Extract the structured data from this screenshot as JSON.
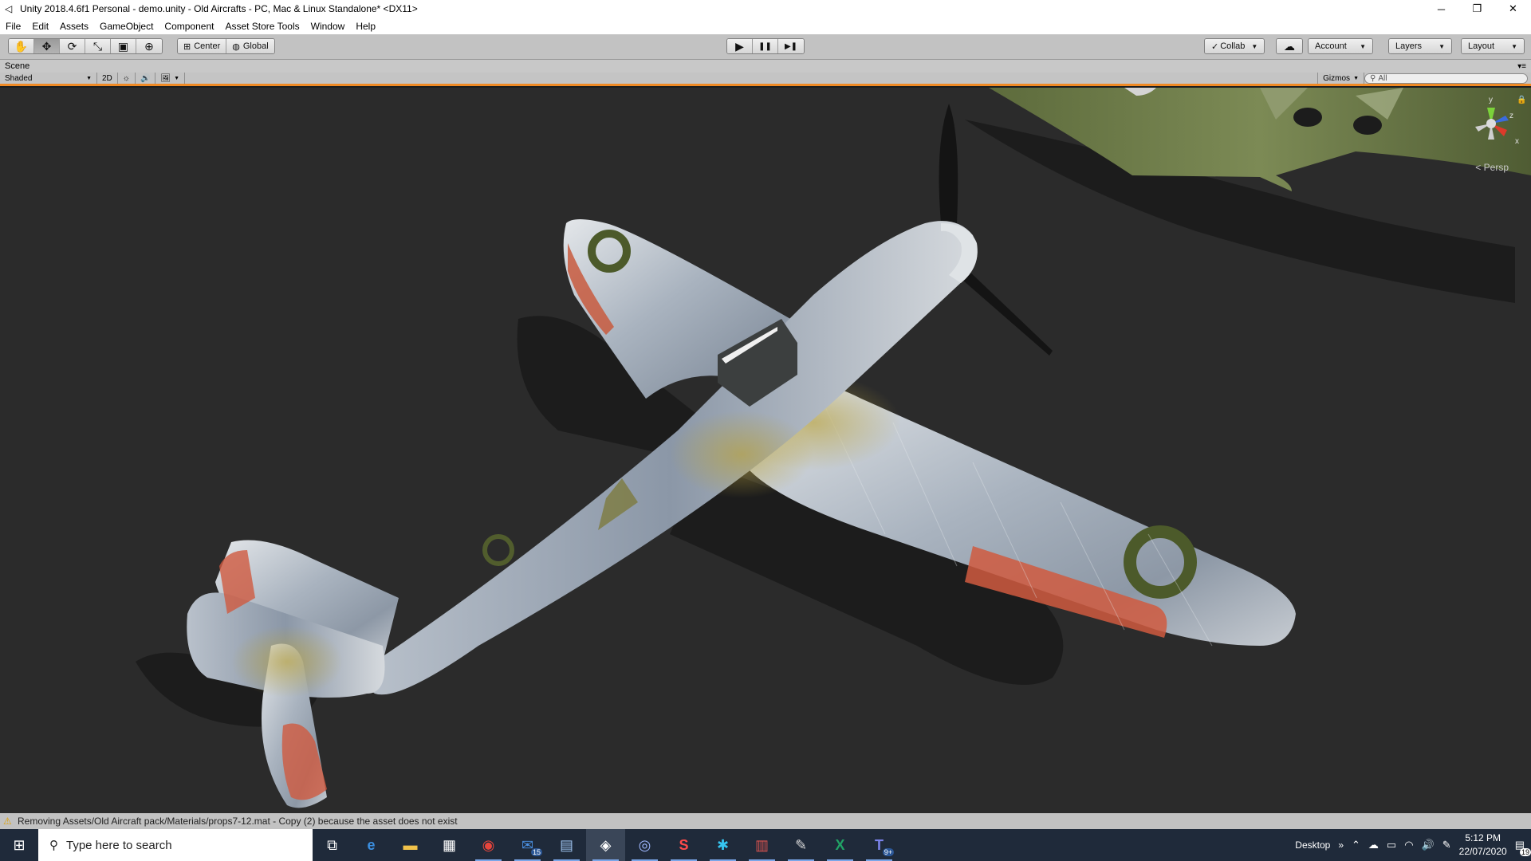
{
  "window": {
    "title": "Unity 2018.4.6f1 Personal - demo.unity - Old Aircrafts - PC, Mac & Linux Standalone* <DX11>",
    "minimize": "─",
    "restore": "❐",
    "close": "✕"
  },
  "menu": [
    "File",
    "Edit",
    "Assets",
    "GameObject",
    "Component",
    "Asset Store Tools",
    "Window",
    "Help"
  ],
  "toolbar": {
    "tools": [
      {
        "name": "hand-tool",
        "glyph": "✋",
        "active": false
      },
      {
        "name": "move-tool",
        "glyph": "✥",
        "active": true
      },
      {
        "name": "rotate-tool",
        "glyph": "⟳",
        "active": false
      },
      {
        "name": "scale-tool",
        "glyph": "⤡",
        "active": false
      },
      {
        "name": "rect-tool",
        "glyph": "▣",
        "active": false
      },
      {
        "name": "transform-tool",
        "glyph": "⊕",
        "active": false
      }
    ],
    "pivot": "Center",
    "space": "Global",
    "play": "▶",
    "pause": "❚❚",
    "step": "▶❚",
    "collab": "Collab",
    "cloud": "☁",
    "account": "Account",
    "layers": "Layers",
    "layout": "Layout"
  },
  "scene": {
    "tab": "Scene",
    "draw_mode": "Shaded",
    "mode_2d": "2D",
    "lighting": "☼",
    "audio": "🔊",
    "effects": "🖼",
    "gizmos": "Gizmos",
    "search_placeholder": "All",
    "persp": "< Persp",
    "gizmo_axes": {
      "y": "y",
      "z": "z",
      "x": "x"
    }
  },
  "status": {
    "message": "Removing Assets/Old Aircraft pack/Materials/props7-12.mat - Copy (2) because the asset does not exist"
  },
  "taskbar": {
    "search_placeholder": "Type here to search",
    "apps": [
      {
        "name": "task-view",
        "glyph": "⧉",
        "running": false
      },
      {
        "name": "edge",
        "glyph": "e",
        "running": false
      },
      {
        "name": "file-explorer",
        "glyph": "▬",
        "running": false
      },
      {
        "name": "store",
        "glyph": "▦",
        "running": false
      },
      {
        "name": "chrome",
        "glyph": "◉",
        "running": true
      },
      {
        "name": "mail",
        "glyph": "✉",
        "running": true,
        "badge": "15"
      },
      {
        "name": "remote",
        "glyph": "▤",
        "running": true
      },
      {
        "name": "unity",
        "glyph": "◈",
        "running": true,
        "active": true
      },
      {
        "name": "cinema",
        "glyph": "◎",
        "running": true
      },
      {
        "name": "substance",
        "glyph": "S",
        "running": true
      },
      {
        "name": "slack",
        "glyph": "✱",
        "running": true
      },
      {
        "name": "archive",
        "glyph": "▥",
        "running": true
      },
      {
        "name": "paint",
        "glyph": "✎",
        "running": true
      },
      {
        "name": "excel",
        "glyph": "X",
        "running": true
      },
      {
        "name": "teams",
        "glyph": "T",
        "running": true,
        "badge": "9+"
      }
    ],
    "desktop": "Desktop",
    "chevron": "»",
    "time": "5:12 PM",
    "date": "22/07/2020",
    "notifications": "19"
  }
}
